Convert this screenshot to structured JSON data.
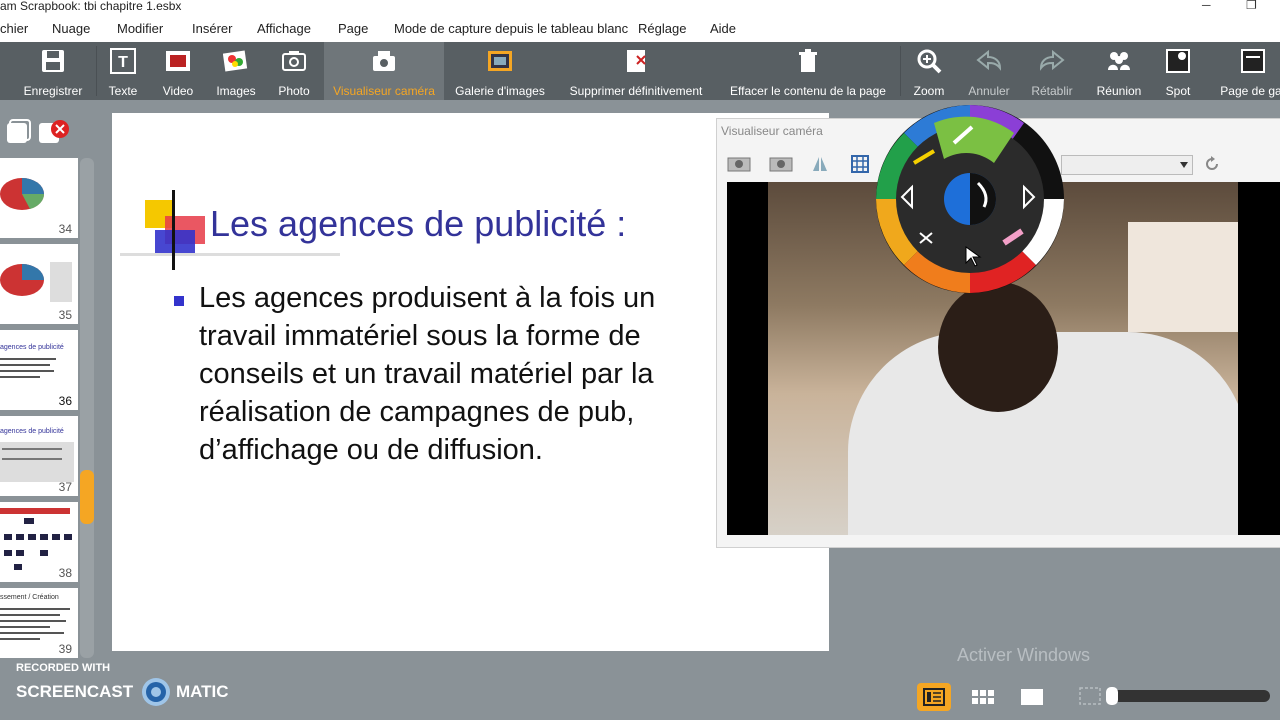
{
  "window": {
    "title": "am Scrapbook: tbi chapitre 1.esbx",
    "minimize": "─",
    "maximize": "❐"
  },
  "menu": {
    "items": [
      "chier",
      "Nuage",
      "Modifier",
      "Insérer",
      "Affichage",
      "Page",
      "Mode de capture depuis le tableau blanc",
      "Réglage",
      "Aide"
    ]
  },
  "toolbar": {
    "buttons": [
      {
        "label": "Enregistrer",
        "icon": "save-icon"
      },
      {
        "label": "Texte",
        "icon": "text-icon"
      },
      {
        "label": "Video",
        "icon": "video-icon"
      },
      {
        "label": "Images",
        "icon": "images-icon"
      },
      {
        "label": "Photo",
        "icon": "photo-icon"
      },
      {
        "label": "Visualiseur caméra",
        "icon": "document-camera-icon",
        "active": true
      },
      {
        "label": "Galerie d'images",
        "icon": "gallery-icon"
      },
      {
        "label": "Supprimer définitivement",
        "icon": "delete-page-icon"
      },
      {
        "label": "Effacer le contenu de la page",
        "icon": "trash-icon"
      },
      {
        "label": "Zoom",
        "icon": "zoom-icon"
      },
      {
        "label": "Annuler",
        "icon": "undo-icon",
        "disabled": true
      },
      {
        "label": "Rétablir",
        "icon": "redo-icon",
        "disabled": true
      },
      {
        "label": "Réunion",
        "icon": "meeting-icon"
      },
      {
        "label": "Spot",
        "icon": "spotlight-icon"
      },
      {
        "label": "Page de gar",
        "icon": "cover-page-icon"
      }
    ]
  },
  "thumbnails": [
    {
      "number": "34"
    },
    {
      "number": "35"
    },
    {
      "number": "36",
      "caption": "agences de publicité"
    },
    {
      "number": "37",
      "caption": "agences de publicité"
    },
    {
      "number": "38"
    },
    {
      "number": "39",
      "caption": "ssement / Création"
    }
  ],
  "slide": {
    "title": "Les agences de publicité :",
    "body": "Les agences produisent à la fois un travail immatériel sous la forme de conseils et un travail matériel par la réalisation de campagnes de pub, d’affichage ou de diffusion."
  },
  "camera_window": {
    "title": "Visualiseur caméra"
  },
  "watermark": {
    "activate_windows": "Activer Windows",
    "recorded_with": "RECORDED WITH",
    "brand_left": "SCREENCAST",
    "brand_right": "MATIC"
  },
  "colors": {
    "toolbar_bg": "#585f63",
    "accent": "#f5a623",
    "slide_title": "#333399"
  }
}
